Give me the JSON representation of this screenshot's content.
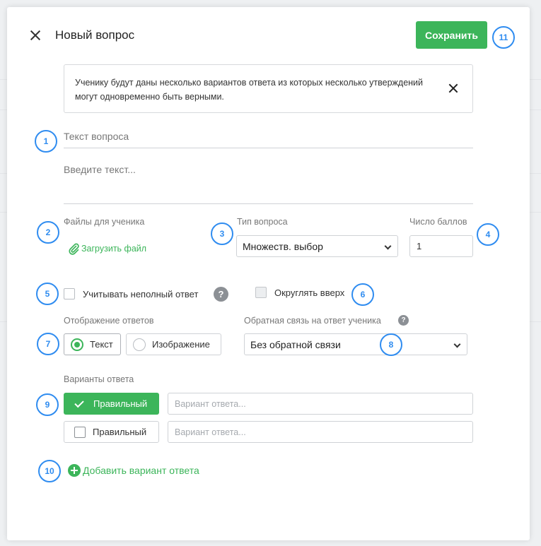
{
  "modal": {
    "title": "Новый вопрос",
    "save_label": "Сохранить"
  },
  "info": {
    "text": "Ученику будут даны несколько вариантов ответа из которых несколько утверждений могут одновременно быть верными."
  },
  "question": {
    "title_placeholder": "Текст вопроса",
    "text_placeholder": "Введите текст..."
  },
  "files": {
    "label": "Файлы для ученика",
    "upload_label": "Загрузить файл"
  },
  "question_type": {
    "label": "Тип вопроса",
    "selected": "Множеств. выбор"
  },
  "points": {
    "label": "Число баллов",
    "value": "1"
  },
  "options": {
    "partial_answer_label": "Учитывать неполный ответ",
    "round_up_label": "Округлять вверх"
  },
  "display": {
    "label": "Отображение ответов",
    "text_option": "Текст",
    "image_option": "Изображение",
    "selected": "Текст"
  },
  "feedback": {
    "label": "Обратная связь на ответ ученика",
    "selected": "Без обратной связи"
  },
  "answers": {
    "label": "Варианты ответа",
    "items": [
      {
        "correct_label": "Правильный",
        "is_correct": true,
        "placeholder": "Вариант ответа..."
      },
      {
        "correct_label": "Правильный",
        "is_correct": false,
        "placeholder": "Вариант ответа..."
      }
    ],
    "add_label": "Добавить вариант ответа"
  },
  "markers": [
    "1",
    "2",
    "3",
    "4",
    "5",
    "6",
    "7",
    "8",
    "9",
    "10",
    "11"
  ],
  "colors": {
    "accent_green": "#3cb55a",
    "marker_blue": "#2f8cf0"
  },
  "icons": {
    "close": "close-icon",
    "help": "question-mark-icon",
    "upload": "paperclip-icon",
    "add": "plus-circle-icon"
  }
}
